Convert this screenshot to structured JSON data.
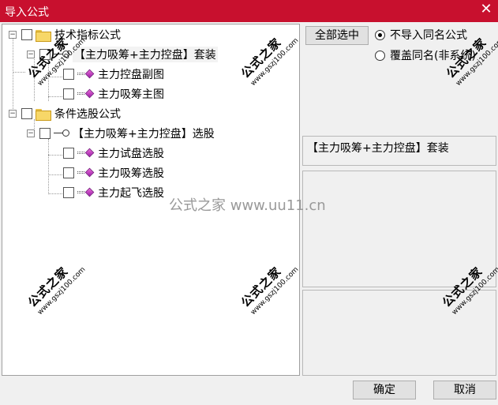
{
  "window": {
    "title": "导入公式",
    "close_glyph": "✕"
  },
  "tree": {
    "groups": [
      {
        "label": "技术指标公式",
        "expander": "−",
        "sets": [
          {
            "label": "【主力吸筹+主力控盘】套装",
            "expander": "−",
            "items": [
              {
                "label": "主力控盘副图"
              },
              {
                "label": "主力吸筹主图"
              }
            ]
          }
        ]
      },
      {
        "label": "条件选股公式",
        "expander": "−",
        "sets": [
          {
            "label": "【主力吸筹+主力控盘】选股",
            "expander": "−",
            "items": [
              {
                "label": "主力试盘选股"
              },
              {
                "label": "主力吸筹选股"
              },
              {
                "label": "主力起飞选股"
              }
            ]
          }
        ]
      }
    ]
  },
  "options": {
    "select_all_label": "全部选中",
    "radio_skip_label": "不导入同名公式",
    "radio_overwrite_label": "覆盖同名(非系统)",
    "selected": "skip"
  },
  "description": {
    "text": "【主力吸筹+主力控盘】套装"
  },
  "footer": {
    "ok_label": "确定",
    "cancel_label": "取消"
  },
  "overlay": {
    "center_text": "公式之家 www.uu11.cn",
    "watermark_big": "公式之家",
    "watermark_small": "www.gszj100.com"
  }
}
